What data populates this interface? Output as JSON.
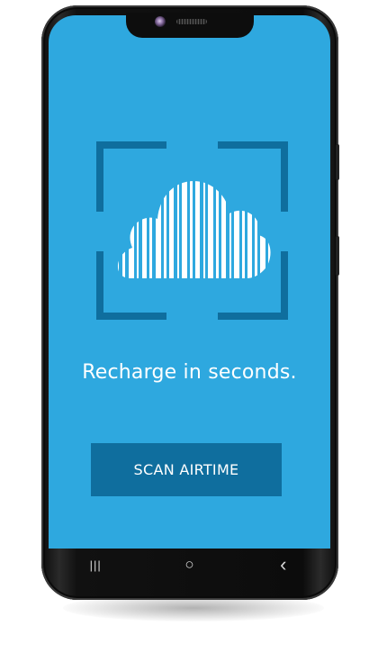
{
  "device": {
    "notch_camera_icon": "front-camera-icon",
    "speaker_icon": "earpiece-speaker-icon"
  },
  "screen": {
    "background_color": "#2ea8df",
    "graphic_icon": "cloud-barcode-scan-icon",
    "tagline": "Recharge in seconds.",
    "scan_button_label": "SCAN AIRTIME",
    "scan_button_color": "#0f6e9e"
  },
  "navbar": {
    "recent_apps_icon": "recent-apps-icon",
    "recent_apps_glyph": "|||",
    "home_icon": "home-icon",
    "home_glyph": "○",
    "back_icon": "back-icon",
    "back_glyph": "‹"
  }
}
